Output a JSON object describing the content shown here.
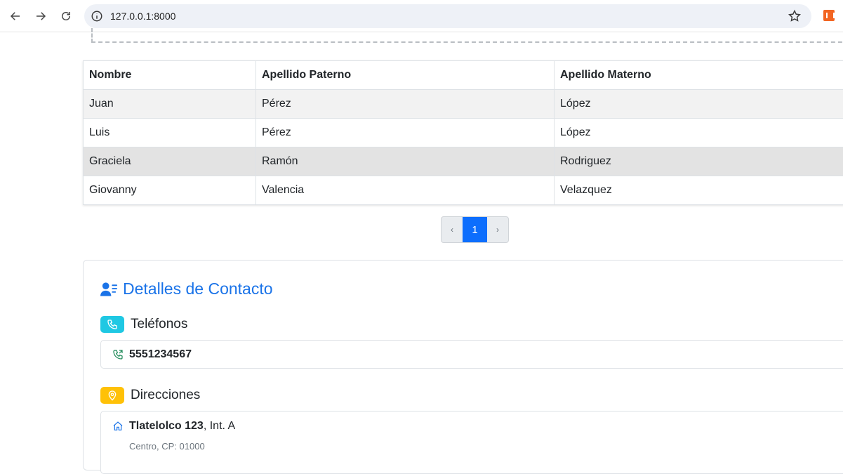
{
  "browser": {
    "url": "127.0.0.1:8000"
  },
  "table": {
    "headers": [
      "Nombre",
      "Apellido Paterno",
      "Apellido Materno"
    ],
    "rows": [
      [
        "Juan",
        "Pérez",
        "López"
      ],
      [
        "Luis",
        "Pérez",
        "López"
      ],
      [
        "Graciela",
        "Ramón",
        "Rodriguez"
      ],
      [
        "Giovanny",
        "Valencia",
        "Velazquez"
      ]
    ]
  },
  "pagination": {
    "prev": "‹",
    "current": "1",
    "next": "›"
  },
  "contact": {
    "title": "Detalles de Contacto",
    "phones_heading": "Teléfonos",
    "phone": "5551234567",
    "addresses_heading": "Direcciones",
    "address_street": "Tlatelolco 123",
    "address_interior": ", Int. A",
    "address_detail": "Centro, CP: 01000"
  },
  "colors": {
    "primary": "#0d6efd",
    "title_blue": "#1a73e8",
    "cyan_badge": "#1fc8e3",
    "yellow_badge": "#ffc107"
  }
}
